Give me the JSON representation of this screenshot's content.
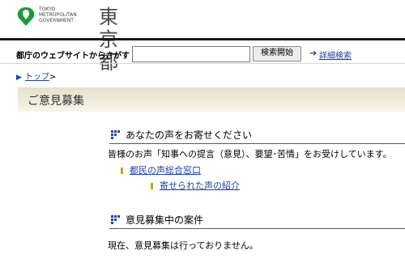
{
  "header": {
    "logo_en_lines": [
      "TOKYO",
      "METROPOLITAN",
      "GOVERNMENT"
    ],
    "logo_jp": "東京都"
  },
  "search": {
    "label": "都庁のウェブサイトからさがす",
    "value": "",
    "placeholder": "",
    "button": "検索開始",
    "advanced_link": "詳細検索"
  },
  "breadcrumb": {
    "home": "トップ",
    "separator": ">"
  },
  "page": {
    "title": "ご意見募集"
  },
  "voice_section": {
    "heading": "あなたの声をお寄せください",
    "description": "皆様のお声「知事への提言（意見）、要望･苦情」をお受けしています。",
    "links": [
      {
        "label": "都民の声総合窓口"
      },
      {
        "label": "寄せられた声の紹介"
      }
    ]
  },
  "cases_section": {
    "heading": "意見募集中の案件",
    "status": "現在、意見募集は行っておりません。"
  },
  "colors": {
    "link": "#1e40a8",
    "logo_green": "#1c9a3b",
    "bullet": "#d4a017",
    "banner": "#e5e0c9"
  }
}
